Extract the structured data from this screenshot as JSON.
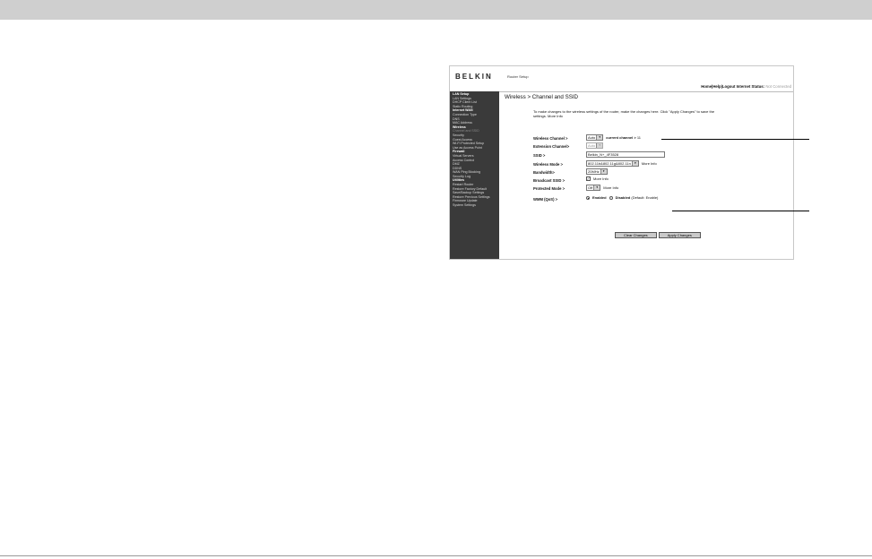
{
  "header": {
    "logo": "BELKIN",
    "logo_sub": "Router Setup",
    "links": "Home|Help|Logout",
    "internet_status_label": "Internet Status:",
    "internet_status_value": "Not Connected"
  },
  "sidebar": {
    "items": [
      {
        "label": "LAN Setup",
        "header": true
      },
      {
        "label": "LAN Settings"
      },
      {
        "label": "DHCP Client List"
      },
      {
        "label": "Static Routing"
      },
      {
        "label": "Internet WAN",
        "header": true
      },
      {
        "label": "Connection Type"
      },
      {
        "label": "DNS"
      },
      {
        "label": "MAC Address"
      },
      {
        "label": "Wireless",
        "header": true
      },
      {
        "label": "Channel and SSID",
        "active": true
      },
      {
        "label": "Security"
      },
      {
        "label": "Guest Access"
      },
      {
        "label": "Wi-Fi Protected Setup"
      },
      {
        "label": "Use as Access Point"
      },
      {
        "label": "Firewall",
        "header": true
      },
      {
        "label": "Virtual Servers"
      },
      {
        "label": "Access Control"
      },
      {
        "label": "DMZ"
      },
      {
        "label": "DDNS"
      },
      {
        "label": "WAN Ping Blocking"
      },
      {
        "label": "Security Log"
      },
      {
        "label": "Utilities",
        "header": true
      },
      {
        "label": "Restart Router"
      },
      {
        "label": "Restore Factory Default"
      },
      {
        "label": "Save/Backup Settings"
      },
      {
        "label": "Restore Previous Settings"
      },
      {
        "label": "Firmware Update"
      },
      {
        "label": "System Settings"
      }
    ]
  },
  "main": {
    "title": "Wireless > Channel and SSID",
    "intro": "To make changes to the wireless settings of the router, make the changes here. Click \"Apply Changes\" to save the settings. More Info",
    "wireless_channel": {
      "label": "Wireless Channel >",
      "value": "Auto",
      "current_label": "current channel >",
      "current_value": "11"
    },
    "extension_channel": {
      "label": "Extension Channel>",
      "value": "Auto"
    },
    "ssid": {
      "label": "SSID >",
      "value": "Belkin_N+_4F3528"
    },
    "wireless_mode": {
      "label": "Wireless Mode >",
      "value": "802.11b&802.11g&802.11n",
      "more": "More Info"
    },
    "bandwidth": {
      "label": "Bandwidth>",
      "value": "20MHz"
    },
    "broadcast_ssid": {
      "label": "Broadcast SSID >",
      "checked": true,
      "more": "More Info"
    },
    "protected_mode": {
      "label": "Protected Mode >",
      "value": "Off",
      "more": "More Info"
    },
    "wmm": {
      "label": "WMM (QoS) >",
      "enabled_label": "Enabled",
      "disabled_label": "Disabled",
      "default_note": "(Default: Enable)",
      "selected": "Enabled"
    },
    "clear_button": "Clear Changes",
    "apply_button": "Apply Changes"
  }
}
